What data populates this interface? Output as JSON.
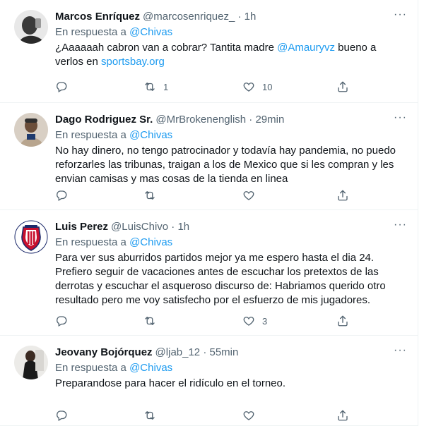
{
  "reply_prefix": "En respuesta a",
  "more_label": "···",
  "colors": {
    "link": "#1d9bf0",
    "muted": "#536471",
    "text": "#0f1419",
    "border": "#eff3f4"
  },
  "tweets": [
    {
      "name": "Marcos Enríquez",
      "handle": "@marcosenriquez_ · 1h",
      "reply_to": "@Chivas",
      "text_parts": [
        "¿Aaaaaah cabron van a cobrar?  Tantita madre ",
        "@Amauryvz",
        " bueno a verlos en ",
        "sportsbay.org"
      ],
      "retweets": "1",
      "likes": "10"
    },
    {
      "name": "Dago Rodriguez Sr.",
      "handle": "@MrBrokenenglish · 29min",
      "reply_to": "@Chivas",
      "text": "No hay dinero, no tengo patrocinador y todavía hay pandemia, no puedo reforzarles las tribunas, traigan a los de Mexico que si les compran y les envian camisas y mas cosas de la tienda en linea",
      "retweets": "",
      "likes": ""
    },
    {
      "name": "Luis Perez",
      "handle": "@LuisChivo · 1h",
      "reply_to": "@Chivas",
      "text": "Para ver sus aburridos partidos mejor ya me espero hasta el dia 24. Prefiero seguir de vacaciones antes de escuchar los pretextos de las derrotas y escuchar el asqueroso discurso de: Habriamos querido otro resultado pero me voy satisfecho por el esfuerzo de mis jugadores.",
      "retweets": "",
      "likes": "3"
    },
    {
      "name": "Jeovany Bojórquez",
      "handle": "@ljab_12 · 55min",
      "reply_to": "@Chivas",
      "text": "Preparandose para hacer el ridículo en el torneo.",
      "retweets": "",
      "likes": ""
    }
  ]
}
